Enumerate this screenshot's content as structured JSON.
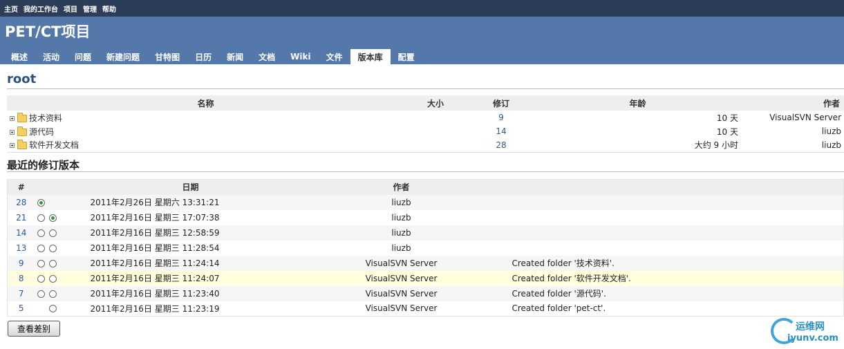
{
  "topbar": {
    "items": [
      "主页",
      "我的工作台",
      "项目",
      "管理",
      "帮助"
    ]
  },
  "header": {
    "project_title": "PET/CT项目",
    "tabs": [
      "概述",
      "活动",
      "问题",
      "新建问题",
      "甘特图",
      "日历",
      "新闻",
      "文档",
      "Wiki",
      "文件",
      "版本库",
      "配置"
    ],
    "active_tab": "版本库"
  },
  "repo": {
    "title": "root",
    "columns": {
      "name": "名称",
      "size": "大小",
      "revision": "修订",
      "age": "年龄",
      "author": "作者"
    },
    "entries": [
      {
        "name": "技术资料",
        "size": "",
        "revision": "9",
        "age": "10 天",
        "author": "VisualSVN Server"
      },
      {
        "name": "源代码",
        "size": "",
        "revision": "14",
        "age": "10 天",
        "author": "liuzb"
      },
      {
        "name": "软件开发文档",
        "size": "",
        "revision": "28",
        "age": "大约  9 小时",
        "author": "liuzb"
      }
    ]
  },
  "revisions": {
    "title": "最近的修订版本",
    "columns": {
      "num": "#",
      "date": "日期",
      "author": "作者"
    },
    "rows": [
      {
        "num": "28",
        "date": "2011年2月26日 星期六  13:31:21",
        "author": "liuzb",
        "message": ""
      },
      {
        "num": "21",
        "date": "2011年2月16日 星期三  17:07:38",
        "author": "liuzb",
        "message": ""
      },
      {
        "num": "14",
        "date": "2011年2月16日 星期三  12:58:59",
        "author": "liuzb",
        "message": ""
      },
      {
        "num": "13",
        "date": "2011年2月16日 星期三  11:28:54",
        "author": "liuzb",
        "message": ""
      },
      {
        "num": "9",
        "date": "2011年2月16日 星期三  11:24:14",
        "author": "VisualSVN Server",
        "message": "Created folder '技术资料'."
      },
      {
        "num": "8",
        "date": "2011年2月16日 星期三  11:24:07",
        "author": "VisualSVN Server",
        "message": "Created folder '软件开发文档'."
      },
      {
        "num": "7",
        "date": "2011年2月16日 星期三  11:23:40",
        "author": "VisualSVN Server",
        "message": "Created folder '源代码'."
      },
      {
        "num": "5",
        "date": "2011年2月16日 星期三  11:23:19",
        "author": "VisualSVN Server",
        "message": "Created folder 'pet-ct'."
      }
    ],
    "diff_button": "查看差别"
  },
  "watermark": {
    "cn": "运维网",
    "en": "iyunv.com"
  }
}
